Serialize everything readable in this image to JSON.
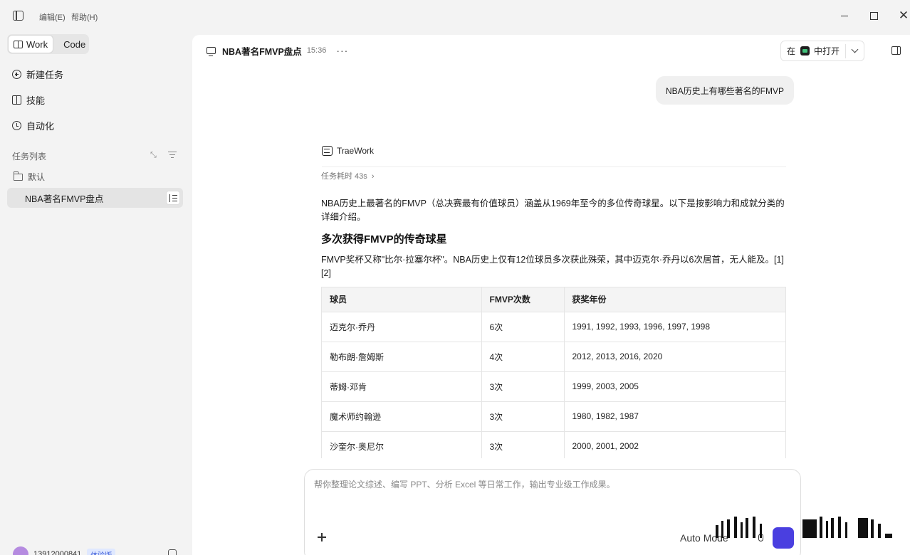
{
  "titlebar": {
    "menu_edit": "编辑(E)",
    "menu_help": "帮助(H)"
  },
  "sidebar": {
    "modes": [
      "Work",
      "Code"
    ],
    "active_mode": "Work",
    "nav": {
      "new_task": "新建任务",
      "skills": "技能",
      "automation": "自动化"
    },
    "task_list_label": "任务列表",
    "folder": "默认",
    "active_task": "NBA著名FMVP盘点",
    "user": {
      "phone": "13912000841",
      "badge": "体验版"
    }
  },
  "header": {
    "title": "NBA著名FMVP盘点",
    "time": "15:36",
    "open_in_prefix": "在",
    "open_in_suffix": "中打开"
  },
  "chat": {
    "user_message": "NBA历史上有哪些著名的FMVP",
    "agent_name": "TraeWork",
    "duration": "任务耗时 43s",
    "intro": "NBA历史上最著名的FMVP（总决赛最有价值球员）涵盖从1969年至今的多位传奇球星。以下是按影响力和成就分类的详细介绍。",
    "section_title": "多次获得FMVP的传奇球星",
    "section_text": "FMVP奖杯又称\"比尔·拉塞尔杯\"。NBA历史上仅有12位球员多次获此殊荣，其中迈克尔·乔丹以6次居首，无人能及。[1][2]",
    "table": {
      "headers": [
        "球员",
        "FMVP次数",
        "获奖年份"
      ],
      "rows": [
        [
          "迈克尔·乔丹",
          "6次",
          "1991, 1992, 1993, 1996, 1997, 1998"
        ],
        [
          "勒布朗·詹姆斯",
          "4次",
          "2012, 2013, 2016, 2020"
        ],
        [
          "蒂姆·邓肯",
          "3次",
          "1999, 2003, 2005"
        ],
        [
          "魔术师约翰逊",
          "3次",
          "1980, 1982, 1987"
        ],
        [
          "沙奎尔·奥尼尔",
          "3次",
          "2000, 2001, 2002"
        ]
      ]
    }
  },
  "composer": {
    "placeholder": "帮你整理论文综述、编写 PPT、分析 Excel 等日常工作，输出专业级工作成果。",
    "value": "",
    "mode_label": "Auto Mode"
  },
  "colors": {
    "accent": "#4a3fe0",
    "sidebar_bg": "#f3f3f3",
    "panel_bg": "#ffffff"
  }
}
